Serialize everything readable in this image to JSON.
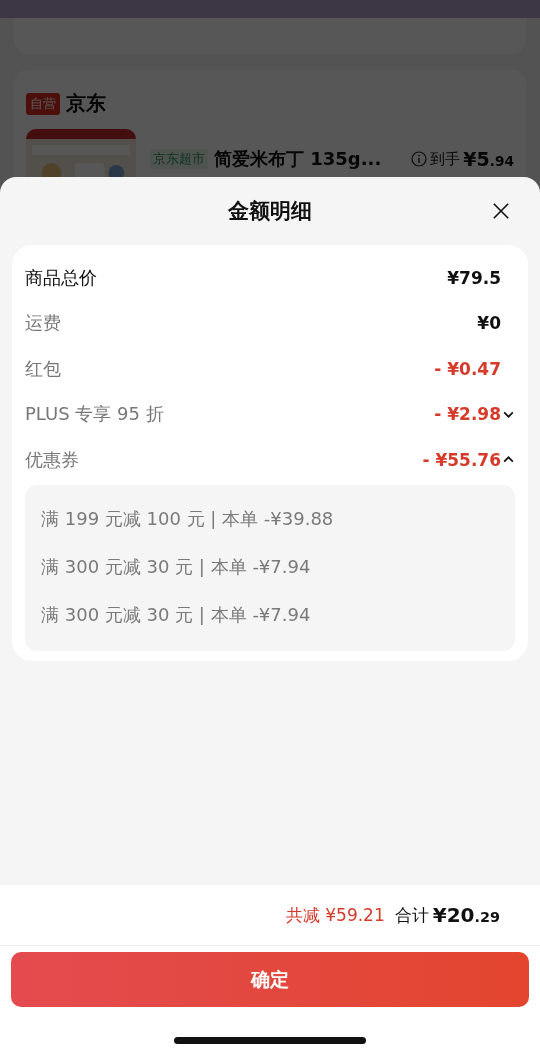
{
  "background_page": {
    "shop": {
      "badge": "自营",
      "name": "京东"
    },
    "product": {
      "tag": "京东超市",
      "title": "简爱米布丁 135g...",
      "price_label": "到手",
      "price_main": "¥5",
      "price_decimal": ".94"
    }
  },
  "sheet": {
    "title": "金额明细",
    "rows": [
      {
        "kind": "total",
        "label": "商品总价",
        "amount": "¥79.5"
      },
      {
        "kind": "plain",
        "label": "运费",
        "amount": "¥0"
      },
      {
        "kind": "discount",
        "label": "红包",
        "amount": "- ¥0.47"
      },
      {
        "kind": "discount",
        "label": "PLUS 专享 95 折",
        "amount": "- ¥2.98",
        "expanded": false
      },
      {
        "kind": "discount",
        "label": "优惠券",
        "amount": "- ¥55.76",
        "expanded": true,
        "details": [
          "满 199 元减 100 元 | 本单 -¥39.88",
          "满 300 元减 30 元 | 本单 -¥7.94",
          "满 300 元减 30 元 | 本单 -¥7.94"
        ]
      }
    ],
    "footer": {
      "saved": "共减 ¥59.21",
      "total_label": "合计",
      "total_main": "¥20",
      "total_decimal": ".29"
    },
    "confirm_button": "确定"
  }
}
